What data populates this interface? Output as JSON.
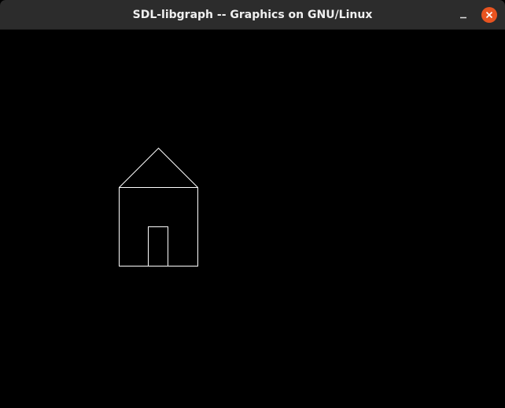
{
  "window": {
    "title": "SDL-libgraph -- Graphics on GNU/Linux",
    "close_color": "#e95420",
    "titlebar_color": "#2c2c2c"
  },
  "controls": {
    "minimize_icon": "minimize-icon",
    "close_icon": "close-icon"
  },
  "canvas": {
    "background_color": "#000000",
    "stroke_color": "#ffffff",
    "drawing": "house outline (roof, walls, door)"
  }
}
